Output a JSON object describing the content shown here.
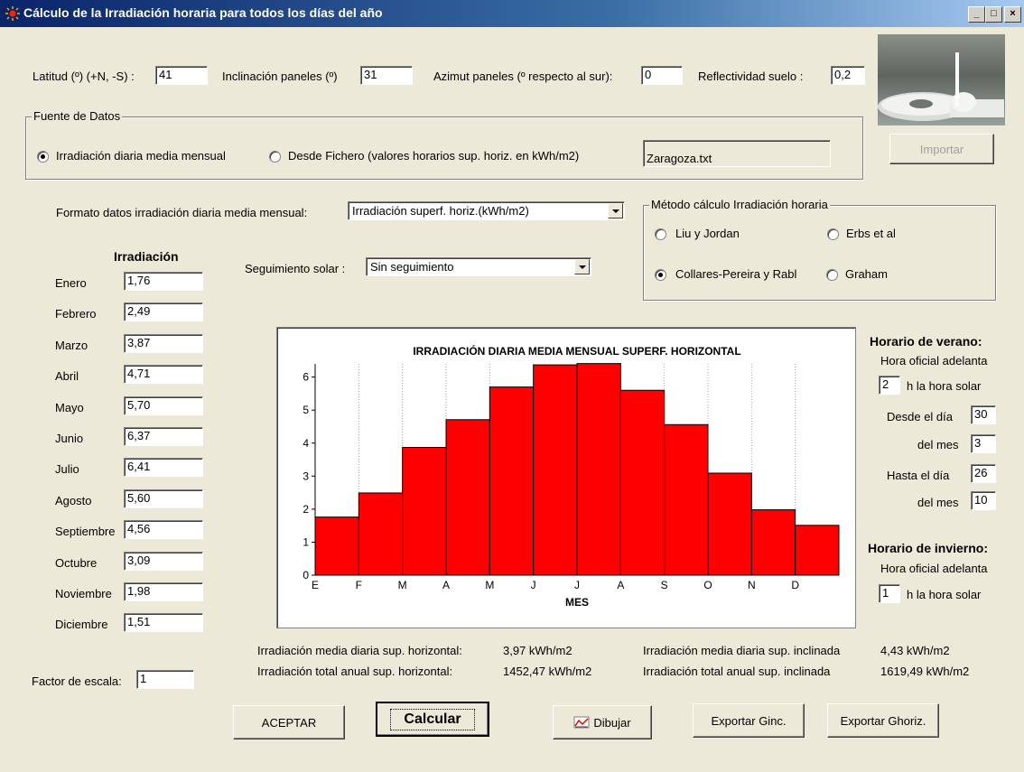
{
  "window": {
    "title": "Cálculo de la Irradiación horaria para todos los días del año",
    "minimize": "_",
    "maximize": "□",
    "close": "×"
  },
  "params": {
    "latitud_label": "Latitud (º) (+N, -S) :",
    "latitud_value": "41",
    "inclinacion_label": "Inclinación paneles (º)",
    "inclinacion_value": "31",
    "azimut_label": "Azimut paneles (º respecto al sur):",
    "azimut_value": "0",
    "reflectividad_label": "Reflectividad suelo :",
    "reflectividad_value": "0,2"
  },
  "fuente": {
    "title": "Fuente de Datos",
    "option1": "Irradiación diaria media mensual",
    "option2": "Desde Fichero (valores horarios sup. horiz. en kWh/m2)",
    "file": "Zaragoza.txt",
    "importar": "Importar"
  },
  "formato": {
    "label": "Formato datos irradiación diaria media mensual:",
    "value": "Irradiación superf. horiz.(kWh/m2)"
  },
  "metodo": {
    "title": "Método cálculo Irradiación horaria",
    "liu": "Liu y Jordan",
    "erbs": "Erbs et al",
    "collares": "Collares-Pereira y Rabl",
    "graham": "Graham"
  },
  "seguimiento": {
    "label": "Seguimiento solar :",
    "value": "Sin seguimiento"
  },
  "irradiacion": {
    "header": "Irradiación",
    "months": [
      {
        "name": "Enero",
        "value": "1,76"
      },
      {
        "name": "Febrero",
        "value": "2,49"
      },
      {
        "name": "Marzo",
        "value": "3,87"
      },
      {
        "name": "Abril",
        "value": "4,71"
      },
      {
        "name": "Mayo",
        "value": "5,70"
      },
      {
        "name": "Junio",
        "value": "6,37"
      },
      {
        "name": "Julio",
        "value": "6,41"
      },
      {
        "name": "Agosto",
        "value": "5,60"
      },
      {
        "name": "Septiembre",
        "value": "4,56"
      },
      {
        "name": "Octubre",
        "value": "3,09"
      },
      {
        "name": "Noviembre",
        "value": "1,98"
      },
      {
        "name": "Diciembre",
        "value": "1,51"
      }
    ]
  },
  "chart_data": {
    "type": "bar",
    "title": "IRRADIACIÓN DIARIA MEDIA MENSUAL SUPERF. HORIZONTAL",
    "xlabel": "MES",
    "ylabel": "",
    "categories": [
      "E",
      "F",
      "M",
      "A",
      "M",
      "J",
      "J",
      "A",
      "S",
      "O",
      "N",
      "D"
    ],
    "values": [
      1.76,
      2.49,
      3.87,
      4.71,
      5.7,
      6.37,
      6.41,
      5.6,
      4.56,
      3.09,
      1.98,
      1.51
    ],
    "yticks": [
      "0",
      "1",
      "2",
      "3",
      "4",
      "5",
      "6"
    ],
    "ylim": [
      0,
      6.4
    ],
    "bar_color": "#ff0000",
    "grid": "vertical-dotted"
  },
  "verano": {
    "title": "Horario de verano:",
    "adelanta": "Hora oficial adelanta",
    "horas": "2",
    "h_solar": "h la hora solar",
    "desde_dia_label": "Desde el día",
    "desde_dia": "30",
    "desde_mes_label": "del mes",
    "desde_mes": "3",
    "hasta_dia_label": "Hasta el día",
    "hasta_dia": "26",
    "hasta_mes_label": "del mes",
    "hasta_mes": "10"
  },
  "invierno": {
    "title": "Horario de invierno:",
    "adelanta": "Hora oficial adelanta",
    "horas": "1",
    "h_solar": "h la hora solar"
  },
  "resultados": {
    "media_horiz_label": "Irradiación media diaria sup. horizontal:",
    "media_horiz_value": "3,97 kWh/m2",
    "total_horiz_label": "Irradiación total anual sup. horizontal:",
    "total_horiz_value": "1452,47 kWh/m2",
    "media_incl_label": "Irradiación media diaria sup. inclinada",
    "media_incl_value": "4,43 kWh/m2",
    "total_incl_label": "Irradiación total anual sup. inclinada",
    "total_incl_value": "1619,49 kWh/m2"
  },
  "escala": {
    "label": "Factor de escala:",
    "value": "1"
  },
  "buttons": {
    "aceptar": "ACEPTAR",
    "calcular": "Calcular",
    "dibujar": "Dibujar",
    "exportar_ginc": "Exportar Ginc.",
    "exportar_ghoriz": "Exportar Ghoriz."
  }
}
